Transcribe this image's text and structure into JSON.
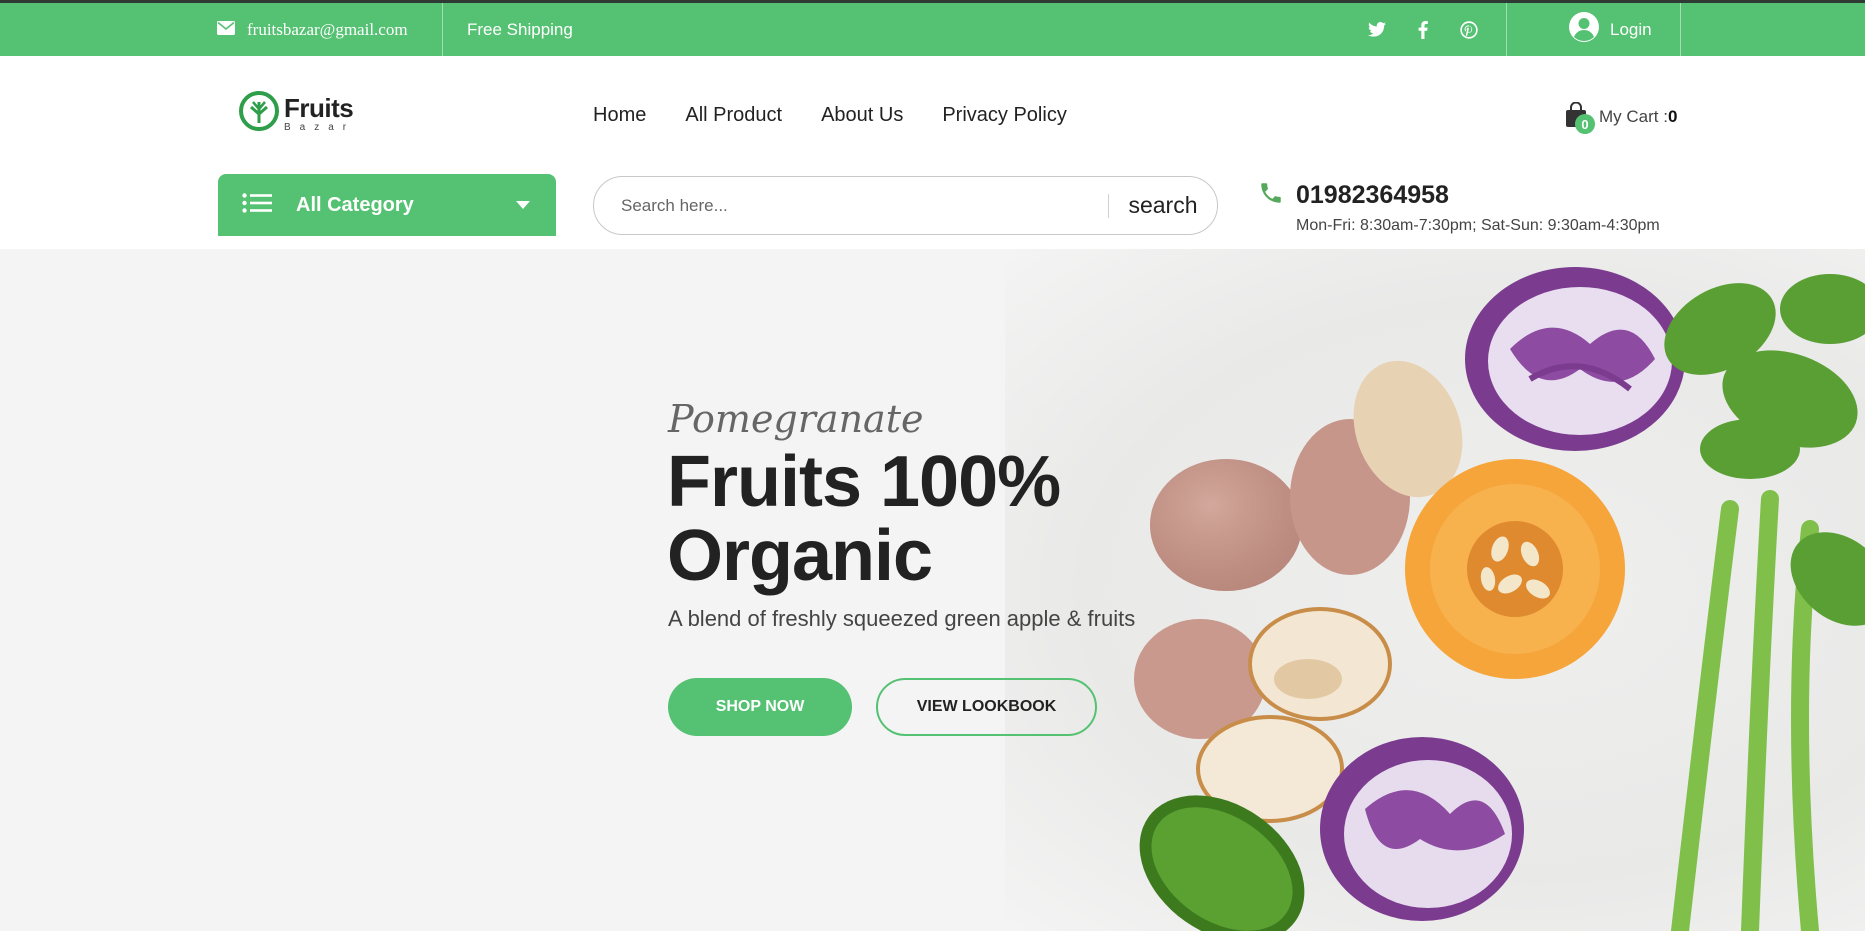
{
  "topbar": {
    "email": "fruitsbazar@gmail.com",
    "shipping": "Free Shipping",
    "social": [
      "twitter-icon",
      "facebook-icon",
      "pinterest-icon"
    ],
    "login": "Login"
  },
  "header": {
    "logo_title": "Fruits",
    "logo_subtitle": "Bazar",
    "nav": [
      "Home",
      "All Product",
      "About Us",
      "Privacy Policy"
    ],
    "cart_label": "My Cart :",
    "cart_count": "0"
  },
  "category": {
    "label": "All Category"
  },
  "search": {
    "placeholder": "Search here...",
    "button": "search"
  },
  "contact": {
    "phone": "01982364958",
    "hours": "Mon-Fri: 8:30am-7:30pm; Sat-Sun: 9:30am-4:30pm"
  },
  "hero": {
    "subtitle": "Pomegranate",
    "title_line1": "Fruits 100%",
    "title_line2": "Organic",
    "description": "A blend of freshly squeezed green apple & fruits",
    "primary_button": "SHOP NOW",
    "secondary_button": "VIEW LOOKBOOK"
  },
  "colors": {
    "brand": "#55c172",
    "text": "#222222",
    "hero_bg": "#f4f4f4"
  }
}
